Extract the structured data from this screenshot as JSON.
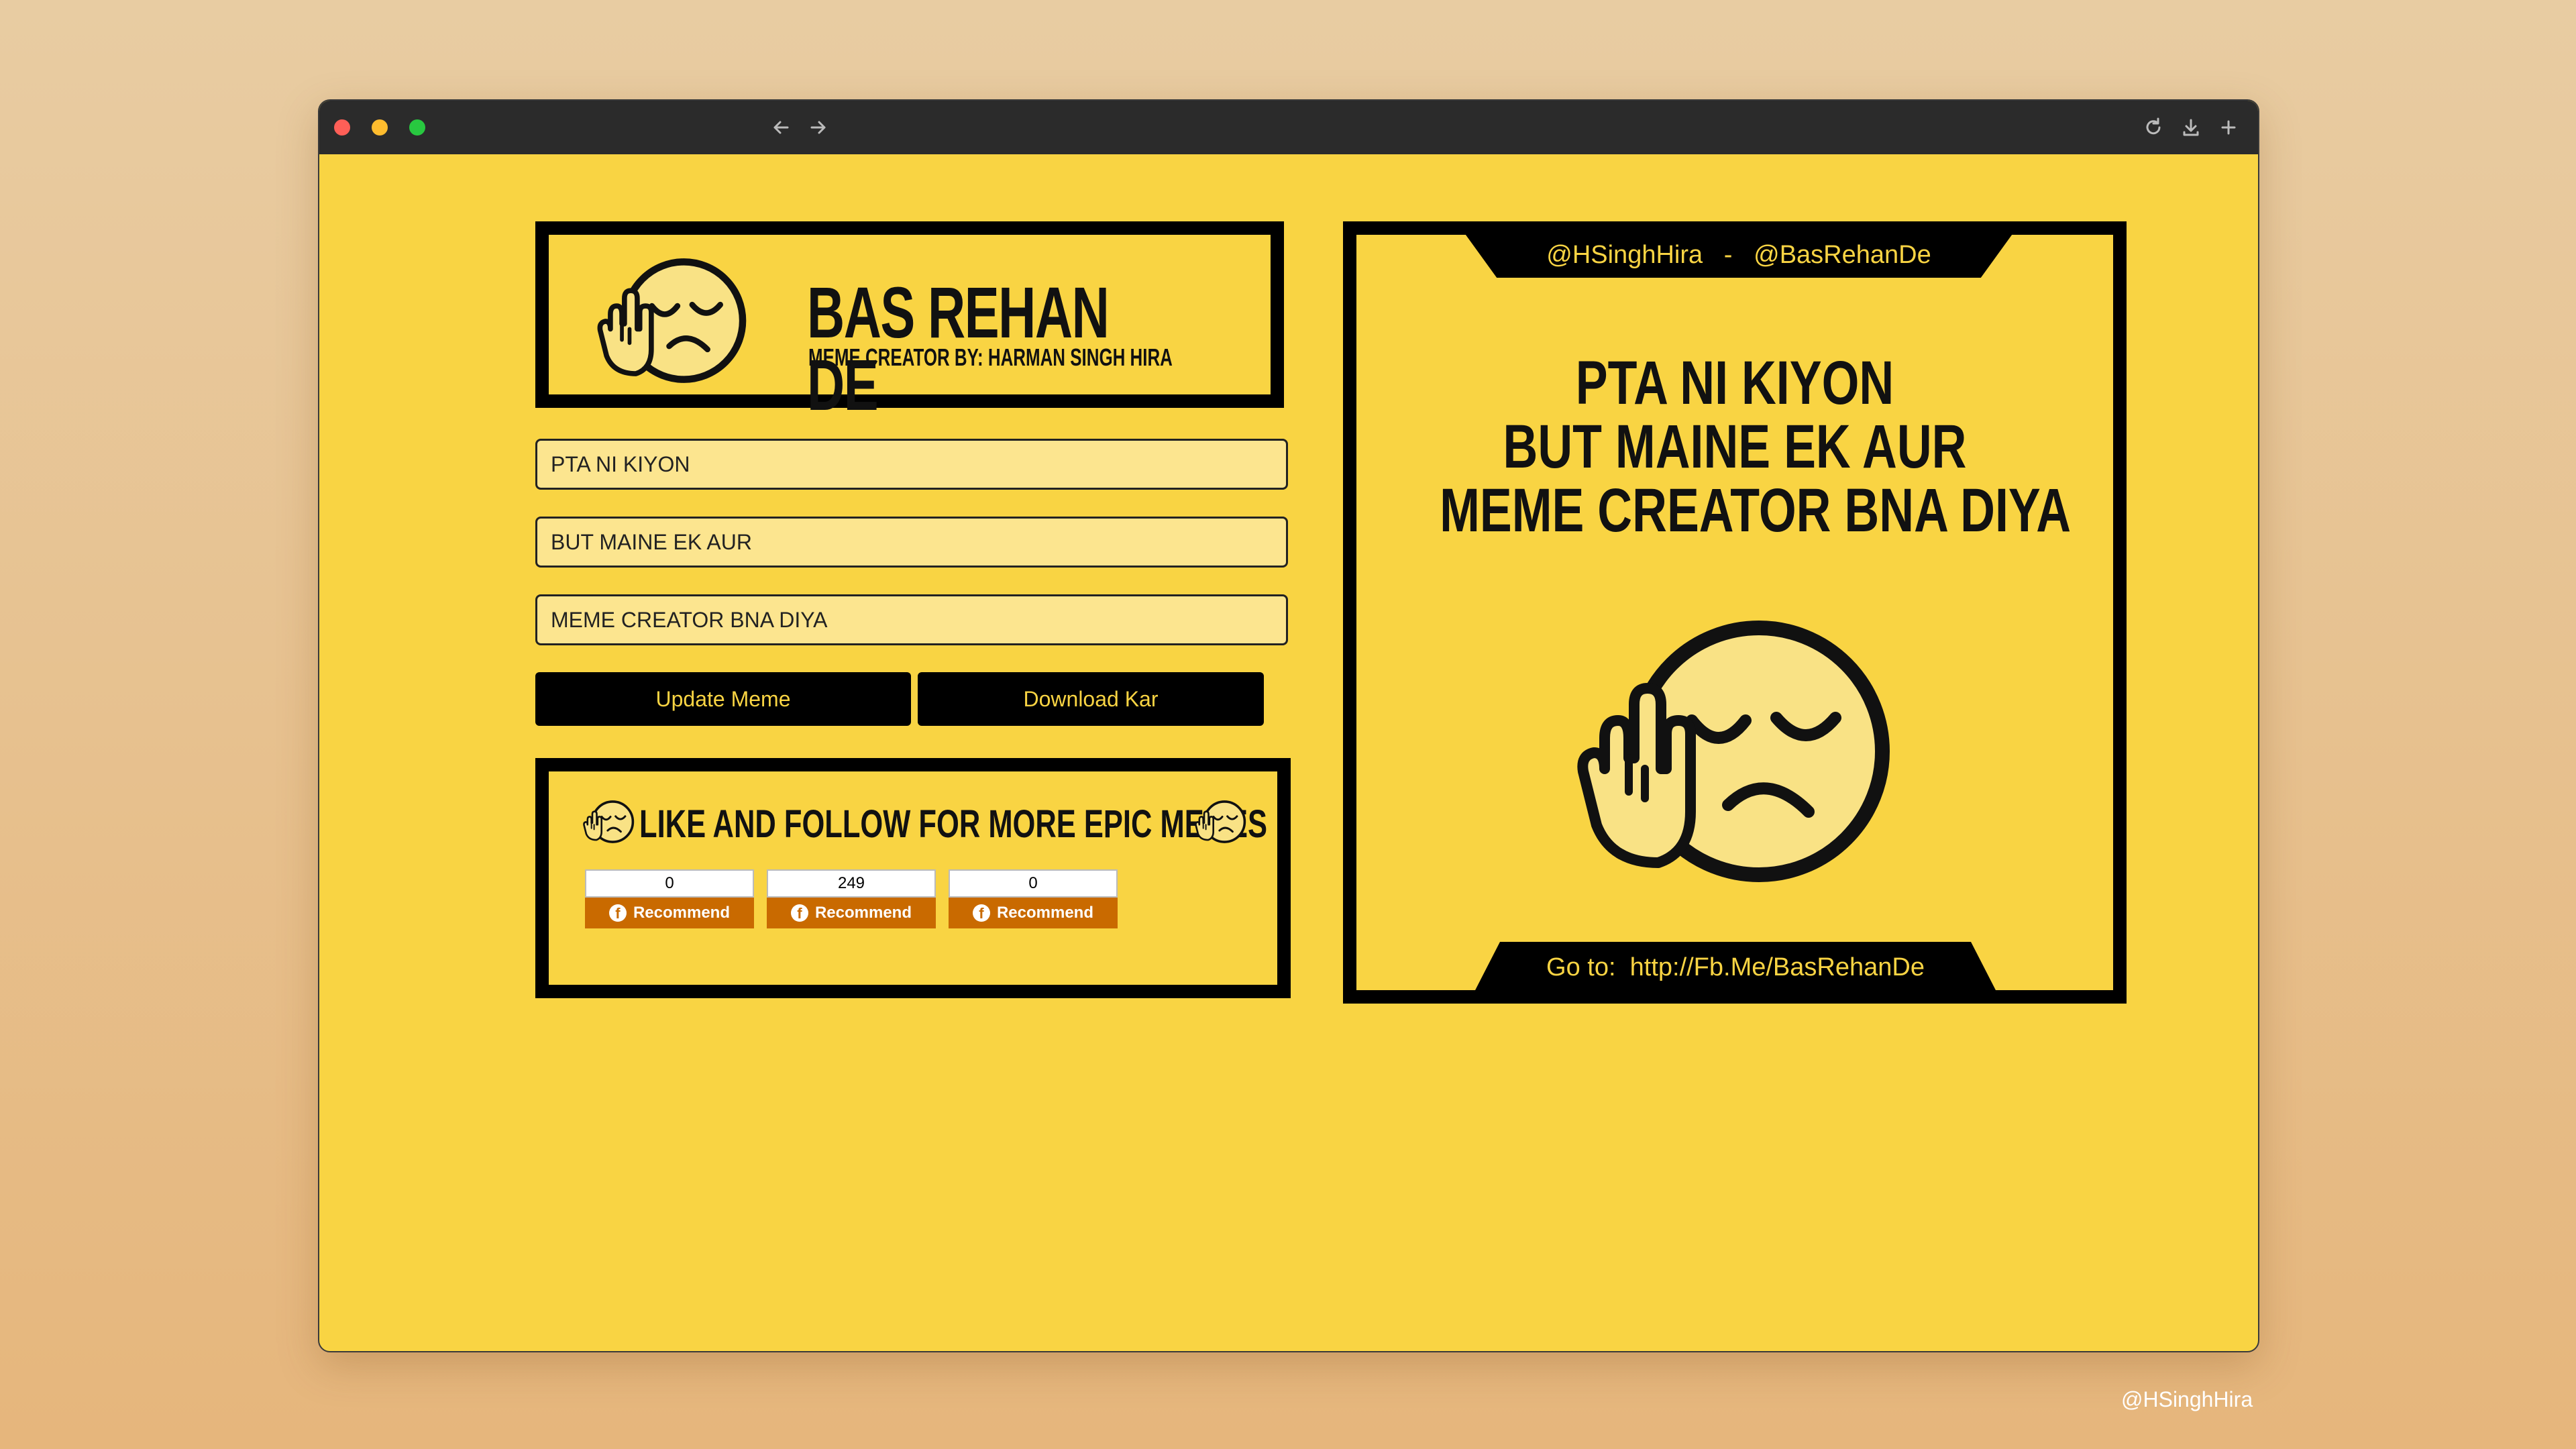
{
  "header": {
    "title": "BAS REHAN DE",
    "subtitle": "MEME CREATOR BY: HARMAN SINGH HIRA"
  },
  "inputs": {
    "line1": "PTA NI KIYON",
    "line2": "BUT MAINE EK AUR",
    "line3": "MEME CREATOR BNA DIYA"
  },
  "buttons": {
    "update": "Update Meme",
    "download": "Download Kar"
  },
  "follow": {
    "title": "LIKE AND FOLLOW FOR MORE EPIC MEMES",
    "widgets": [
      {
        "count": "0",
        "label": "Recommend"
      },
      {
        "count": "249",
        "label": "Recommend"
      },
      {
        "count": "0",
        "label": "Recommend"
      }
    ]
  },
  "meme": {
    "handles": "@HSinghHira   -   @BasRehanDe",
    "lines": [
      "PTA NI KIYON",
      "BUT MAINE EK AUR",
      "MEME CREATOR BNA DIYA"
    ],
    "footer": "Go to:  http://Fb.Me/BasRehanDe"
  },
  "credit": "@HSinghHira",
  "colors": {
    "page_yellow": "#f9d443",
    "input_fill": "#fce58f",
    "recommend_orange": "#c96a00",
    "chrome_dark": "#2b2b2b"
  },
  "icons": {
    "titlebar_left": [
      "back-arrow-icon",
      "forward-arrow-icon"
    ],
    "titlebar_right": [
      "reload-icon",
      "download-icon",
      "plus-icon"
    ],
    "emoji": "annoyed-face-hand-icon"
  }
}
